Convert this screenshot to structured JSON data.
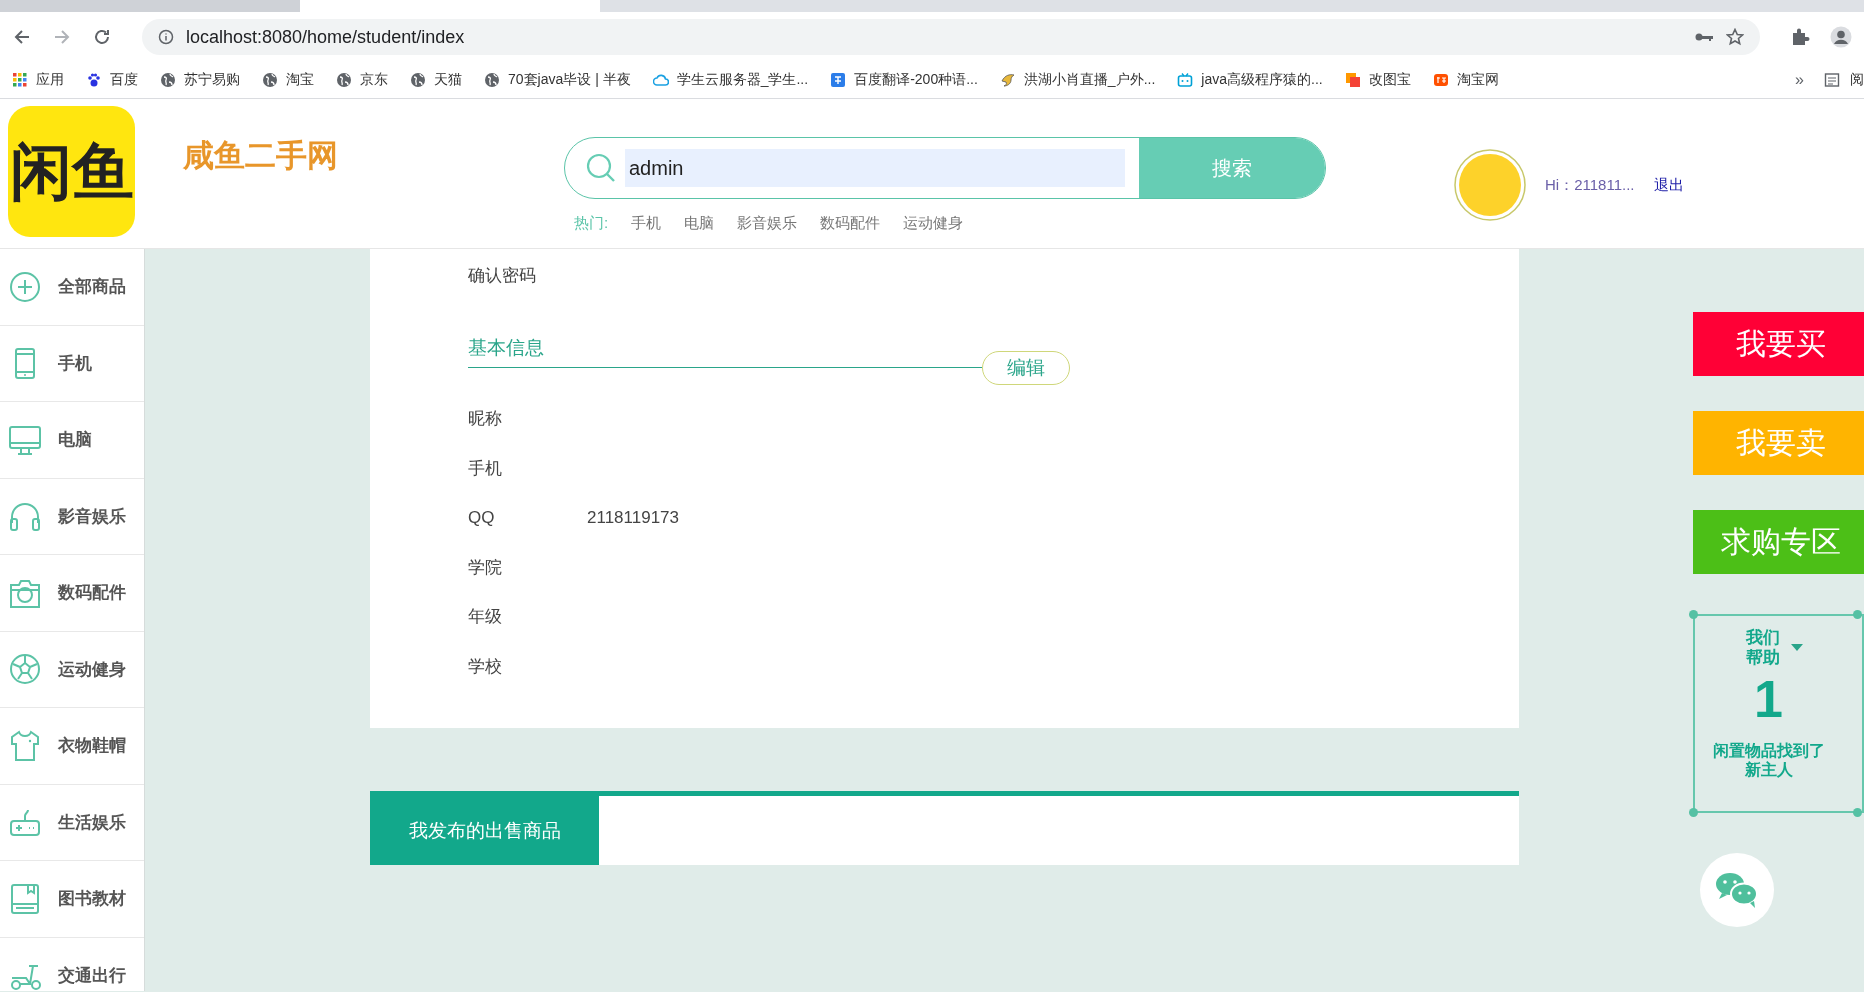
{
  "browser": {
    "url": "localhost:8080/home/student/index",
    "bookmarks": [
      {
        "label": "应用",
        "kind": "apps"
      },
      {
        "label": "百度",
        "kind": "paw"
      },
      {
        "label": "苏宁易购",
        "kind": "globe"
      },
      {
        "label": "淘宝",
        "kind": "globe"
      },
      {
        "label": "京东",
        "kind": "globe"
      },
      {
        "label": "天猫",
        "kind": "globe"
      },
      {
        "label": "70套java毕设 | 半夜",
        "kind": "globe"
      },
      {
        "label": "学生云服务器_学生...",
        "kind": "cloud"
      },
      {
        "label": "百度翻译-200种语...",
        "kind": "translate"
      },
      {
        "label": "洪湖小肖直播_户外...",
        "kind": "bird"
      },
      {
        "label": "java高级程序猿的...",
        "kind": "tv"
      },
      {
        "label": "改图宝",
        "kind": "square"
      },
      {
        "label": "淘宝网",
        "kind": "tao"
      }
    ],
    "more": "»",
    "reading_list": "阅"
  },
  "header": {
    "logo": "闲鱼",
    "site_title": "咸鱼二手网",
    "search": {
      "value": "admin",
      "button": "搜索"
    },
    "hot_label": "热门:",
    "hot_links": [
      "手机",
      "电脑",
      "影音娱乐",
      "数码配件",
      "运动健身"
    ],
    "greeting": "Hi：211811...",
    "logout": "退出"
  },
  "sidebar": {
    "items": [
      {
        "label": "全部商品",
        "kind": "plus"
      },
      {
        "label": "手机",
        "kind": "phone"
      },
      {
        "label": "电脑",
        "kind": "monitor"
      },
      {
        "label": "影音娱乐",
        "kind": "headphones"
      },
      {
        "label": "数码配件",
        "kind": "camera"
      },
      {
        "label": "运动健身",
        "kind": "ball"
      },
      {
        "label": "衣物鞋帽",
        "kind": "shirt"
      },
      {
        "label": "生活娱乐",
        "kind": "gamepad"
      },
      {
        "label": "图书教材",
        "kind": "book"
      },
      {
        "label": "交通出行",
        "kind": "scooter"
      }
    ]
  },
  "profile": {
    "top_label": "确认密码",
    "section_title": "基本信息",
    "edit_button": "编辑",
    "fields": [
      {
        "label": "昵称"
      },
      {
        "label": "手机"
      },
      {
        "label": "QQ",
        "value": "2118119173"
      },
      {
        "label": "学院"
      },
      {
        "label": "年级"
      },
      {
        "label": "学校"
      }
    ]
  },
  "listing_tab": {
    "label": "我发布的出售商品"
  },
  "right_panel": {
    "buttons": [
      {
        "label": "我要买",
        "color": "#ff0036"
      },
      {
        "label": "我要卖",
        "color": "#ffb400"
      },
      {
        "label": "求购专区",
        "color": "#4cbf17"
      }
    ],
    "help": {
      "title": "我们帮助",
      "count": "1",
      "caption": "闲置物品找到了新主人"
    }
  }
}
